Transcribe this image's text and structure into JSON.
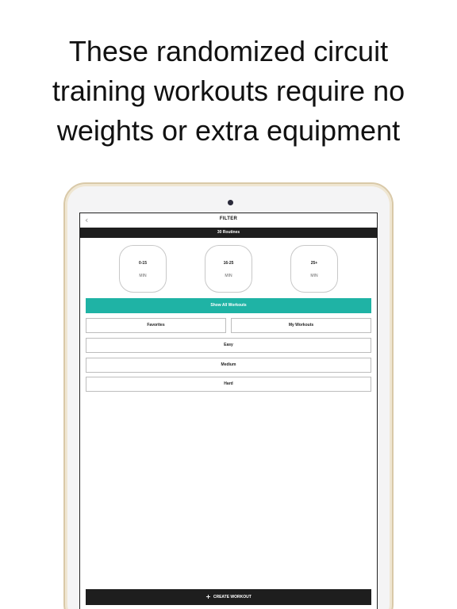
{
  "headline": {
    "line1": "These randomized circuit",
    "line2": "training workouts require no",
    "line3": "weights or extra equipment"
  },
  "app": {
    "title": "FILTER",
    "back_icon": "chevron-left-icon",
    "routines_count": "30 Routines",
    "durations": [
      {
        "range": "0-15",
        "unit": "MIN"
      },
      {
        "range": "16-25",
        "unit": "MIN"
      },
      {
        "range": "25+",
        "unit": "MIN"
      }
    ],
    "show_all_label": "Show All Workouts",
    "favorites_label": "Favorites",
    "my_workouts_label": "My Workouts",
    "difficulty": [
      "Easy",
      "Medium",
      "Hard"
    ],
    "create_label": "CREATE WORKOUT",
    "create_icon": "plus-icon"
  },
  "colors": {
    "accent": "#1fb3a5",
    "dark": "#1e1e1e",
    "device_frame": "#d9c9a8"
  }
}
